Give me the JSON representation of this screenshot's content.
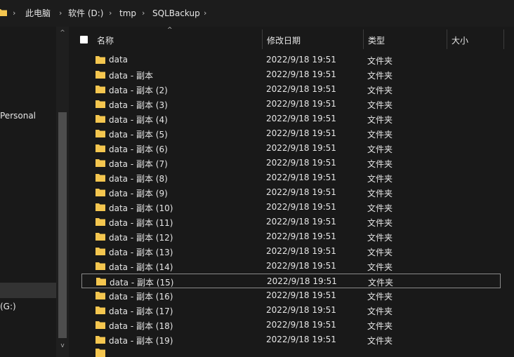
{
  "breadcrumb": {
    "items": [
      "此电脑",
      "软件 (D:)",
      "tmp",
      "SQLBackup"
    ],
    "separator": "›"
  },
  "nav": {
    "personal_label": "Personal",
    "drive_label": "(G:)"
  },
  "columns": {
    "name": "名称",
    "modified": "修改日期",
    "type": "类型",
    "size": "大小"
  },
  "files": [
    {
      "name": "data",
      "modified": "2022/9/18 19:51",
      "type": "文件夹"
    },
    {
      "name": "data - 副本",
      "modified": "2022/9/18 19:51",
      "type": "文件夹"
    },
    {
      "name": "data - 副本 (2)",
      "modified": "2022/9/18 19:51",
      "type": "文件夹"
    },
    {
      "name": "data - 副本 (3)",
      "modified": "2022/9/18 19:51",
      "type": "文件夹"
    },
    {
      "name": "data - 副本 (4)",
      "modified": "2022/9/18 19:51",
      "type": "文件夹"
    },
    {
      "name": "data - 副本 (5)",
      "modified": "2022/9/18 19:51",
      "type": "文件夹"
    },
    {
      "name": "data - 副本 (6)",
      "modified": "2022/9/18 19:51",
      "type": "文件夹"
    },
    {
      "name": "data - 副本 (7)",
      "modified": "2022/9/18 19:51",
      "type": "文件夹"
    },
    {
      "name": "data - 副本 (8)",
      "modified": "2022/9/18 19:51",
      "type": "文件夹"
    },
    {
      "name": "data - 副本 (9)",
      "modified": "2022/9/18 19:51",
      "type": "文件夹"
    },
    {
      "name": "data - 副本 (10)",
      "modified": "2022/9/18 19:51",
      "type": "文件夹"
    },
    {
      "name": "data - 副本 (11)",
      "modified": "2022/9/18 19:51",
      "type": "文件夹"
    },
    {
      "name": "data - 副本 (12)",
      "modified": "2022/9/18 19:51",
      "type": "文件夹"
    },
    {
      "name": "data - 副本 (13)",
      "modified": "2022/9/18 19:51",
      "type": "文件夹"
    },
    {
      "name": "data - 副本 (14)",
      "modified": "2022/9/18 19:51",
      "type": "文件夹"
    },
    {
      "name": "data - 副本 (15)",
      "modified": "2022/9/18 19:51",
      "type": "文件夹",
      "selected": true
    },
    {
      "name": "data - 副本 (16)",
      "modified": "2022/9/18 19:51",
      "type": "文件夹"
    },
    {
      "name": "data - 副本 (17)",
      "modified": "2022/9/18 19:51",
      "type": "文件夹"
    },
    {
      "name": "data - 副本 (18)",
      "modified": "2022/9/18 19:51",
      "type": "文件夹"
    },
    {
      "name": "data - 副本 (19)",
      "modified": "2022/9/18 19:51",
      "type": "文件夹"
    }
  ],
  "colors": {
    "background": "#191919",
    "folder": "#f4c64f",
    "text": "#e6e6e6"
  }
}
